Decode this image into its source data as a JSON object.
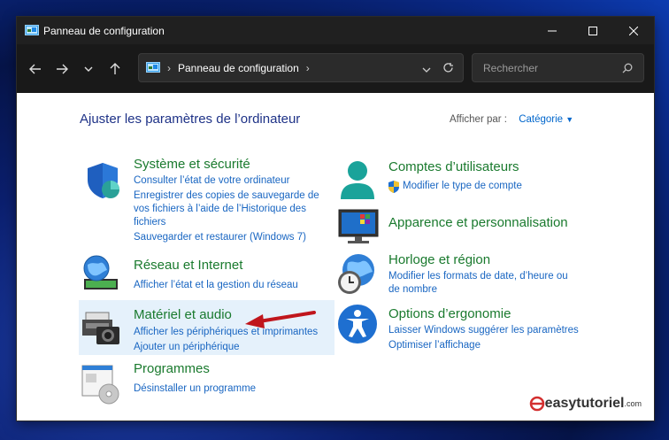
{
  "window": {
    "title": "Panneau de configuration"
  },
  "address": {
    "crumb": "Panneau de configuration"
  },
  "search": {
    "placeholder": "Rechercher"
  },
  "header": {
    "title": "Ajuster les paramètres de l’ordinateur",
    "view_label": "Afficher par :",
    "view_value": "Catégorie"
  },
  "categories": [
    {
      "title": "Système et sécurité",
      "links": [
        "Consulter l’état de votre ordinateur",
        "Enregistrer des copies de sauvegarde de",
        "vos fichiers à l’aide de l’Historique des",
        "fichiers",
        "Sauvegarder et restaurer (Windows 7)"
      ]
    },
    {
      "title": "Réseau et Internet",
      "links": [
        "Afficher l’état et la gestion du réseau"
      ]
    },
    {
      "title": "Matériel et audio",
      "links": [
        "Afficher les périphériques et imprimantes",
        "Ajouter un périphérique"
      ]
    },
    {
      "title": "Programmes",
      "links": [
        "Désinstaller un programme"
      ]
    },
    {
      "title": "Comptes d’utilisateurs",
      "links": [
        "Modifier le type de compte"
      ]
    },
    {
      "title": "Apparence et personnalisation",
      "links": []
    },
    {
      "title": "Horloge et région",
      "links": [
        "Modifier les formats de date, d’heure ou",
        "de nombre"
      ]
    },
    {
      "title": "Options d’ergonomie",
      "links": [
        "Laisser Windows suggérer les paramètres",
        "Optimiser l’affichage"
      ]
    }
  ],
  "watermark": {
    "text": "easytutoriel",
    "suffix": ".com"
  },
  "colors": {
    "accent": "#0066cc",
    "category_green": "#1a7a2e",
    "heading_blue": "#1e3287",
    "arrow_red": "#c0161c"
  }
}
